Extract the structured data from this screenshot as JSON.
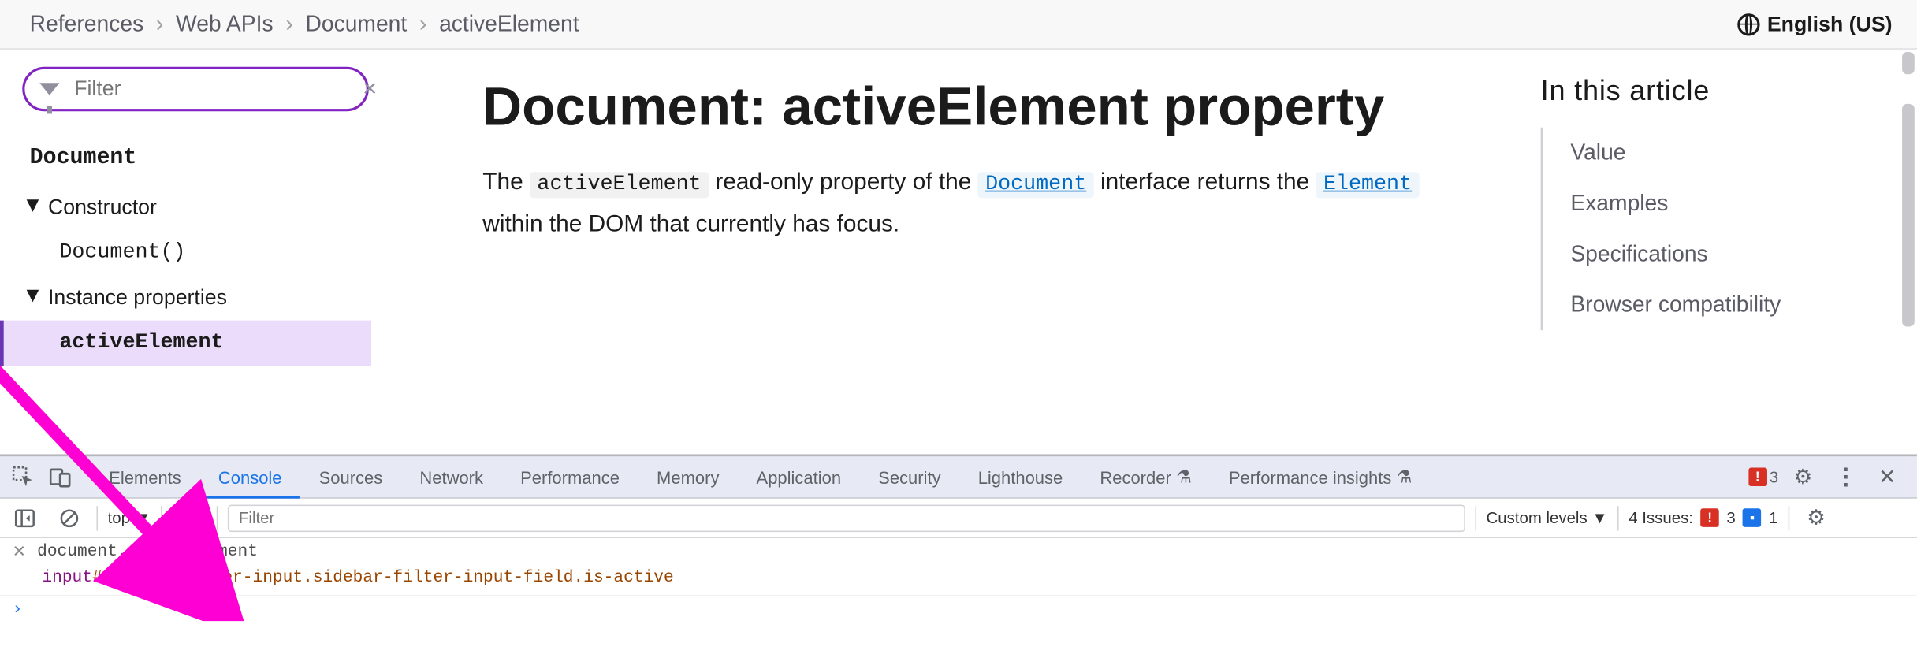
{
  "breadcrumbs": [
    "References",
    "Web APIs",
    "Document",
    "activeElement"
  ],
  "language": "English (US)",
  "sidebar": {
    "filter_placeholder": "Filter",
    "heading": "Document",
    "group_constructor": "Constructor",
    "item_constructor": "Document()",
    "group_instance": "Instance properties",
    "item_active": "activeElement"
  },
  "article": {
    "title": "Document: activeElement property",
    "intro_1": "The ",
    "intro_code1": "activeElement",
    "intro_2": " read-only property of the ",
    "intro_link1": "Document",
    "intro_3": " interface returns the ",
    "intro_link2": "Element",
    "intro_4": " within the DOM that currently has focus."
  },
  "toc": {
    "heading": "In this article",
    "items": [
      "Value",
      "Examples",
      "Specifications",
      "Browser compatibility"
    ]
  },
  "devtools": {
    "tabs": [
      "Elements",
      "Console",
      "Sources",
      "Network",
      "Performance",
      "Memory",
      "Application",
      "Security",
      "Lighthouse",
      "Recorder",
      "Performance insights"
    ],
    "active_tab": "Console",
    "error_count": "3",
    "toolbar": {
      "context": "top",
      "filter_placeholder": "Filter",
      "levels": "Custom levels",
      "issues_label": "4 Issues:",
      "issues_err": "3",
      "issues_info": "1"
    },
    "console": {
      "input_expr": "document.activeElement",
      "result_tag": "input",
      "result_rest": "#sidebar-filter-input.sidebar-filter-input-field.is-active"
    }
  }
}
